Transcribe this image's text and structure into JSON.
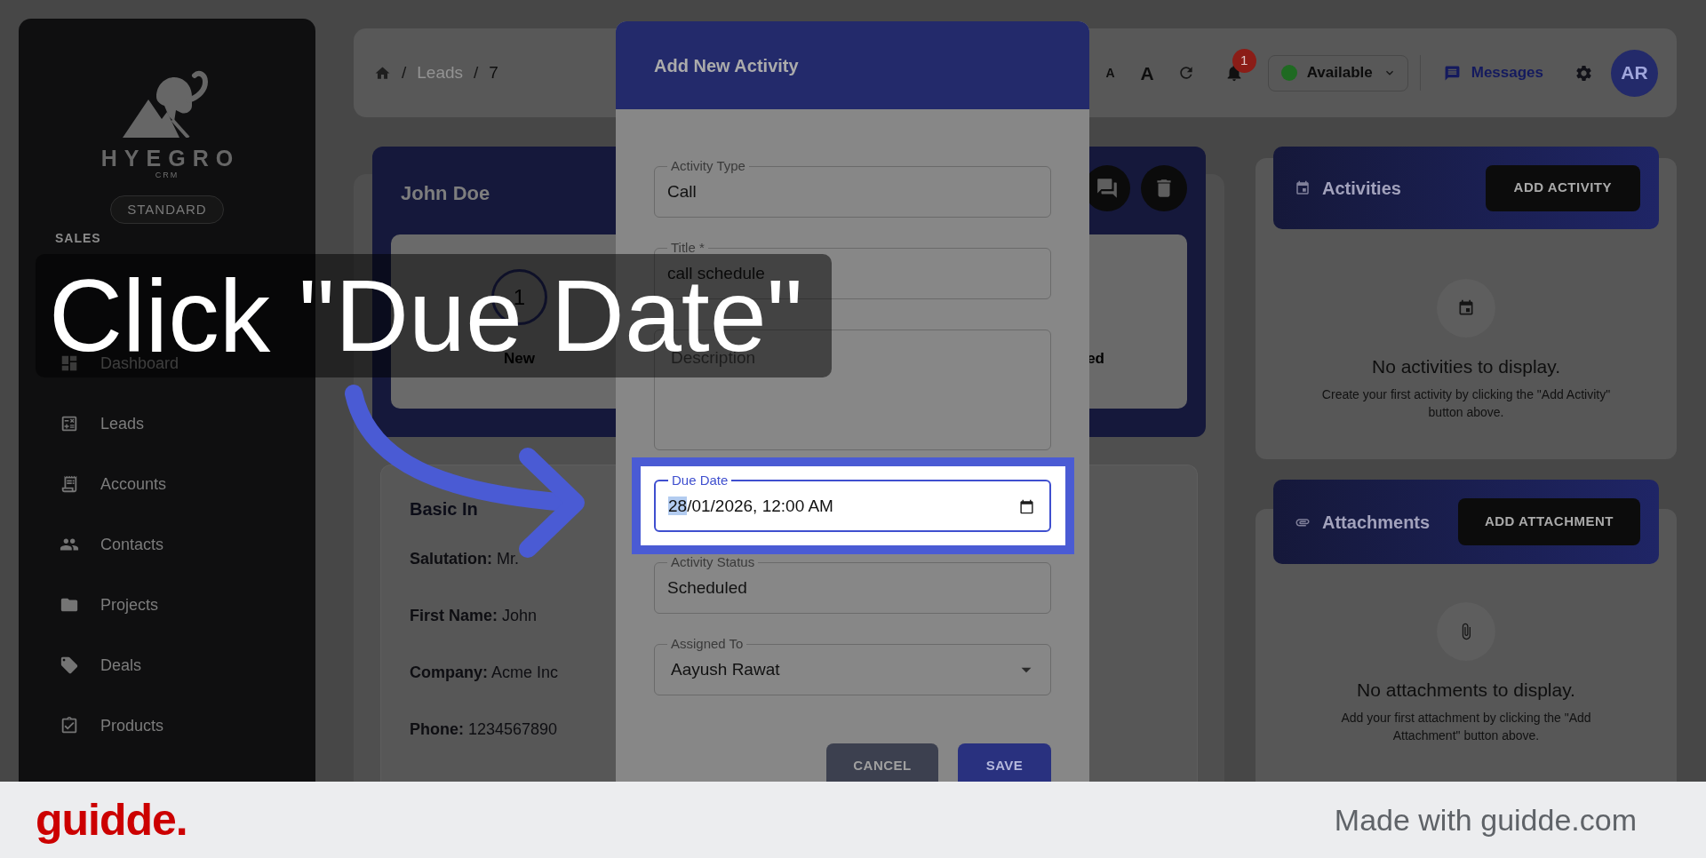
{
  "sidebar": {
    "brand": "HYEGRO",
    "brand_subtitle": "CRM",
    "plan": "STANDARD",
    "section": "SALES",
    "items": [
      "Dashboard",
      "Leads",
      "Accounts",
      "Contacts",
      "Projects",
      "Deals",
      "Products"
    ]
  },
  "header": {
    "breadcrumb": [
      {
        "separator": "/",
        "label": "Leads"
      },
      {
        "separator": "/",
        "label": "7"
      }
    ],
    "font_smaller": "A",
    "font_larger": "A",
    "notification_count": "1",
    "status": "Available",
    "messages": "Messages",
    "avatar": "AR"
  },
  "lead_card": {
    "name": "John Doe",
    "stage": {
      "number": "1",
      "label": "New"
    },
    "stage_label_partial": "ed"
  },
  "info_card": {
    "title": "Basic In",
    "rows": [
      "**Salutation:** Mr.",
      "**First Name:** John",
      "**Company:** Acme Inc",
      "**Phone:** 1234567890"
    ]
  },
  "activities": {
    "title": "Activities",
    "button": "ADD ACTIVITY",
    "empty_title": "No activities to display.",
    "empty_text": "Create your first activity by clicking the \"Add Activity\" button above."
  },
  "attachments": {
    "title": "Attachments",
    "button": "ADD ATTACHMENT",
    "empty_title": "No attachments to display.",
    "empty_text": "Add your first attachment by clicking the \"Add Attachment\" button above."
  },
  "dialog": {
    "title": "Add New Activity",
    "fields": [
      {
        "kind": "text",
        "label": "Activity Type",
        "value": "Call",
        "focused": false,
        "highlighted": false
      },
      {
        "kind": "text",
        "label": "Title *",
        "value": "call schedule",
        "focused": false,
        "highlighted": false
      },
      {
        "kind": "textarea",
        "placeholder": "Description",
        "focused": false,
        "highlighted": false
      },
      {
        "kind": "datetime",
        "label": "Due Date",
        "segments": [
          {
            "text": "28",
            "selected": true
          },
          {
            "text": "/01/2026, 12:00 AM",
            "selected": false
          }
        ],
        "focused": true,
        "highlighted": true
      },
      {
        "kind": "text",
        "label": "Activity Status",
        "value": "Scheduled",
        "focused": false,
        "highlighted": false
      },
      {
        "kind": "select",
        "label": "Assigned To",
        "value": "Aayush Rawat",
        "focused": false,
        "highlighted": false
      }
    ],
    "buttons": [
      {
        "label": "CANCEL",
        "kind": "secondary"
      },
      {
        "label": "SAVE",
        "kind": "primary"
      }
    ]
  },
  "tutorial": {
    "caption": "Click \"Due Date\""
  },
  "footer": {
    "logo": "guidde.",
    "credit": "Made with guidde.com"
  }
}
